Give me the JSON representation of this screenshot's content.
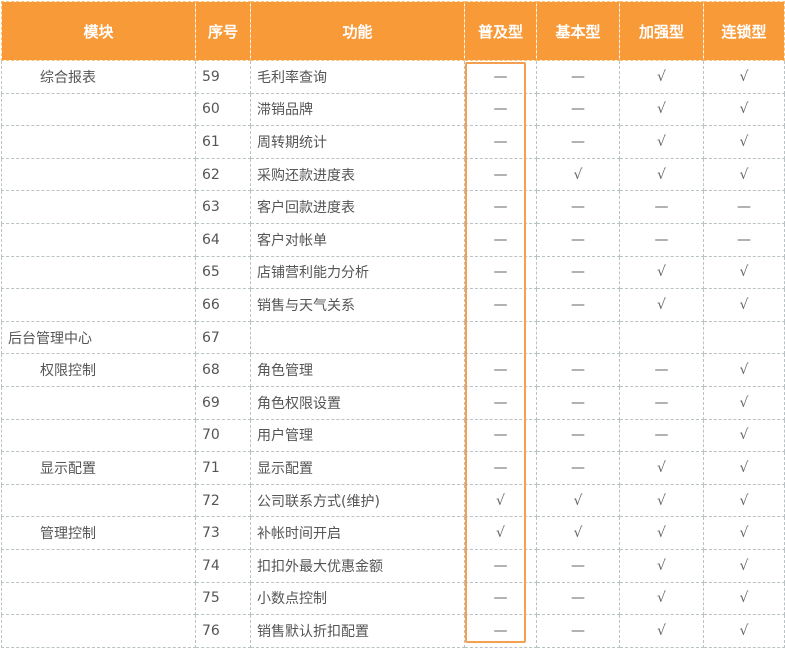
{
  "headers": {
    "module": "模块",
    "number": "序号",
    "function": "功能",
    "basic_plus": "普及型",
    "basic": "基本型",
    "enhanced": "加强型",
    "chain": "连锁型"
  },
  "rows": [
    {
      "module": "综合报表",
      "indent": true,
      "number": "59",
      "function": "毛利率查询",
      "marks": [
        "—",
        "—",
        "√",
        "√"
      ]
    },
    {
      "module": "",
      "indent": false,
      "number": "60",
      "function": "滞销品牌",
      "marks": [
        "—",
        "—",
        "√",
        "√"
      ]
    },
    {
      "module": "",
      "indent": false,
      "number": "61",
      "function": "周转期统计",
      "marks": [
        "—",
        "—",
        "√",
        "√"
      ]
    },
    {
      "module": "",
      "indent": false,
      "number": "62",
      "function": "采购还款进度表",
      "marks": [
        "—",
        "√",
        "√",
        "√"
      ]
    },
    {
      "module": "",
      "indent": false,
      "number": "63",
      "function": "客户回款进度表",
      "marks": [
        "—",
        "—",
        "—",
        "—"
      ]
    },
    {
      "module": "",
      "indent": false,
      "number": "64",
      "function": "客户对帐单",
      "marks": [
        "—",
        "—",
        "—",
        "—"
      ]
    },
    {
      "module": "",
      "indent": false,
      "number": "65",
      "function": "店铺营利能力分析",
      "marks": [
        "—",
        "—",
        "√",
        "√"
      ]
    },
    {
      "module": "",
      "indent": false,
      "number": "66",
      "function": "销售与天气关系",
      "marks": [
        "—",
        "—",
        "√",
        "√"
      ]
    },
    {
      "module": "后台管理中心",
      "indent": false,
      "number": "67",
      "function": "",
      "marks": [
        "",
        "",
        "",
        ""
      ]
    },
    {
      "module": "权限控制",
      "indent": true,
      "number": "68",
      "function": "角色管理",
      "marks": [
        "—",
        "—",
        "—",
        "√"
      ]
    },
    {
      "module": "",
      "indent": false,
      "number": "69",
      "function": "角色权限设置",
      "marks": [
        "—",
        "—",
        "—",
        "√"
      ]
    },
    {
      "module": "",
      "indent": false,
      "number": "70",
      "function": "用户管理",
      "marks": [
        "—",
        "—",
        "—",
        "√"
      ]
    },
    {
      "module": "显示配置",
      "indent": true,
      "number": "71",
      "function": "显示配置",
      "marks": [
        "—",
        "—",
        "√",
        "√"
      ]
    },
    {
      "module": "",
      "indent": false,
      "number": "72",
      "function": "公司联系方式(维护)",
      "marks": [
        "√",
        "√",
        "√",
        "√"
      ]
    },
    {
      "module": "管理控制",
      "indent": true,
      "number": "73",
      "function": "补帐时间开启",
      "marks": [
        "√",
        "√",
        "√",
        "√"
      ]
    },
    {
      "module": "",
      "indent": false,
      "number": "74",
      "function": "扣扣外最大优惠金额",
      "marks": [
        "—",
        "—",
        "√",
        "√"
      ]
    },
    {
      "module": "",
      "indent": false,
      "number": "75",
      "function": "小数点控制",
      "marks": [
        "—",
        "—",
        "√",
        "√"
      ]
    },
    {
      "module": "",
      "indent": false,
      "number": "76",
      "function": "销售默认折扣配置",
      "marks": [
        "—",
        "—",
        "√",
        "√"
      ]
    }
  ],
  "highlight_color": "#f5a04e",
  "header_color": "#f99a38"
}
